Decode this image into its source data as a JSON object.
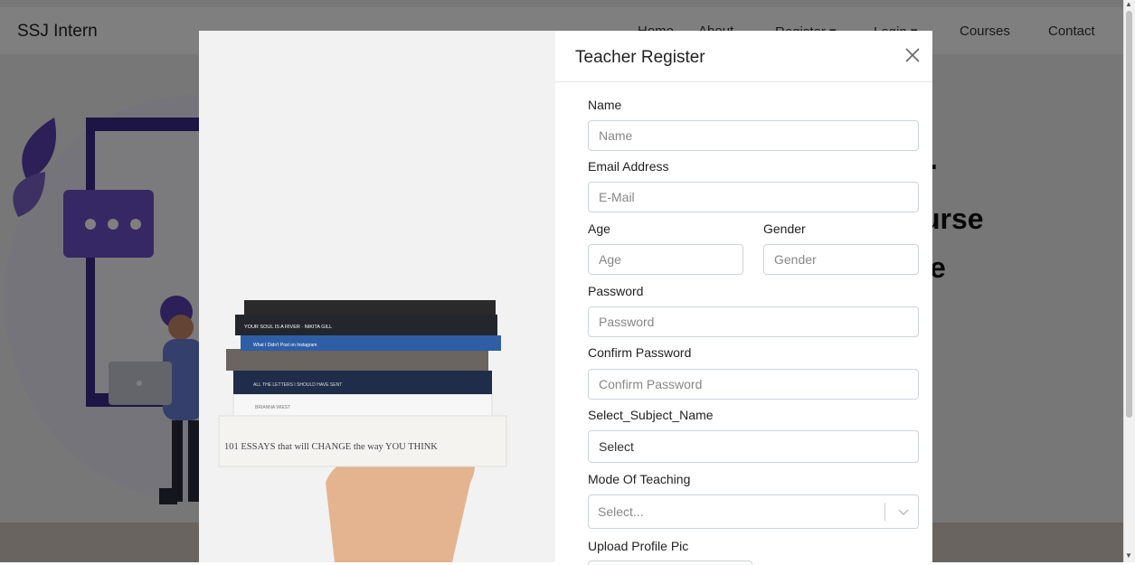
{
  "navbar": {
    "brand": "SSJ Intern",
    "items": [
      {
        "label": "Home"
      },
      {
        "label": "About"
      },
      {
        "label": "Register ▾"
      },
      {
        "label": "Login ▾"
      },
      {
        "label": "Courses"
      },
      {
        "label": "Contact"
      }
    ]
  },
  "hero": {
    "line1": ".",
    "line2": "urse",
    "line3": "e"
  },
  "modal": {
    "title": "Teacher Register",
    "close_icon": "close-icon",
    "fields": {
      "name": {
        "label": "Name",
        "placeholder": "Name"
      },
      "email": {
        "label": "Email Address",
        "placeholder": "E-Mail"
      },
      "age": {
        "label": "Age",
        "placeholder": "Age"
      },
      "gender": {
        "label": "Gender",
        "placeholder": "Gender"
      },
      "password": {
        "label": "Password",
        "placeholder": "Password"
      },
      "confirm_password": {
        "label": "Confirm Password",
        "placeholder": "Confirm Password"
      },
      "subject": {
        "label": "Select_Subject_Name",
        "value": "Select"
      },
      "mode": {
        "label": "Mode Of Teaching",
        "placeholder": "Select..."
      },
      "profile_pic": {
        "label": "Upload Profile Pic"
      }
    },
    "book_spines": [
      "YOUR SOUL IS A RIVER · NIKITA GILL",
      "What I Didn't Post on Instagram",
      "ALL THE LETTERS I SHOULD HAVE SENT",
      "BRIANNA WIEST",
      "101 ESSAYS that will CHANGE the way YOU THINK"
    ]
  },
  "colors": {
    "accent_purple": "#5a3fb0",
    "backdrop": "rgba(0,0,0,0.5)"
  }
}
